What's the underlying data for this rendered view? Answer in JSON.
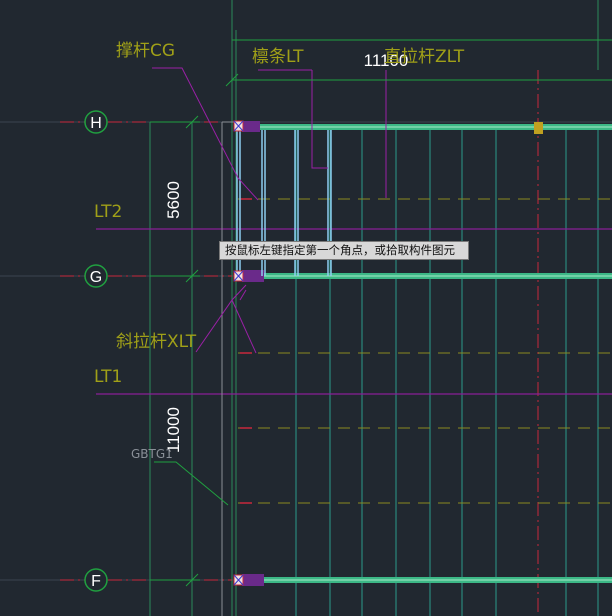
{
  "cad_view": {
    "axes": {
      "H": "H",
      "G": "G",
      "F": "F"
    },
    "dimensions": {
      "top_span": "11100",
      "H_to_G": "5600",
      "G_to_F": "11000"
    },
    "labels": {
      "strut": "撑杆CG",
      "purlin": "檩条LT",
      "straight_tie": "直拉杆ZLT",
      "diagonal_tie": "斜拉杆XLT",
      "lt2": "LT2",
      "lt1": "LT1",
      "gbtg": "GBTG1"
    },
    "prompt_tooltip": "按鼠标左键指定第一个角点，或拾取构件图元"
  },
  "colors": {
    "background": "#212830",
    "label_text": "#a0a018",
    "beam_green": "#3cb886",
    "purlin_blue": "#8ecdf0",
    "leader_magenta": "#9a20a6",
    "axis_red": "#c8283c",
    "dim_green": "#20a040"
  }
}
